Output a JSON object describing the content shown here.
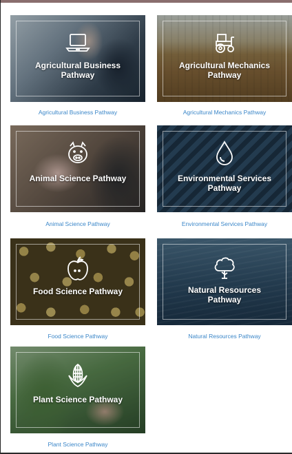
{
  "pathways": [
    {
      "title": "Agricultural Business Pathway",
      "caption": "Agricultural Business Pathway",
      "icon": "laptop-icon"
    },
    {
      "title": "Agricultural Mechanics Pathway",
      "caption": "Agricultural Mechanics Pathway",
      "icon": "tractor-icon"
    },
    {
      "title": "Animal Science Pathway",
      "caption": "Animal Science Pathway",
      "icon": "pig-icon"
    },
    {
      "title": "Environmental Services Pathway",
      "caption": "Environmental Services Pathway",
      "icon": "water-drop-icon"
    },
    {
      "title": "Food Science Pathway",
      "caption": "Food Science Pathway",
      "icon": "apple-icon"
    },
    {
      "title": "Natural Resources Pathway",
      "caption": "Natural Resources Pathway",
      "icon": "tree-icon"
    },
    {
      "title": "Plant Science Pathway",
      "caption": "Plant Science Pathway",
      "icon": "corn-icon"
    }
  ],
  "colors": {
    "caption_link": "#3a86c8",
    "title_text": "#ffffff",
    "top_bar": "#8a6e6e"
  }
}
